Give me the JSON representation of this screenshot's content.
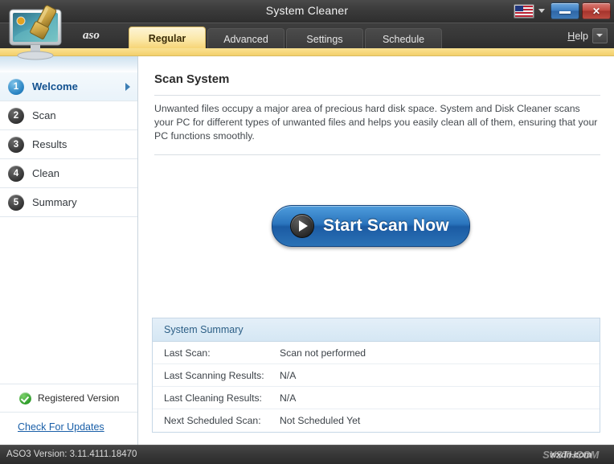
{
  "window": {
    "title": "System Cleaner",
    "flag_icon": "us-flag-icon",
    "flag_caret_icon": "caret-down-icon",
    "minimize_label": "",
    "close_label": "✕"
  },
  "brand": {
    "logo_icon": "monitor-brush-logo-icon",
    "aso_label": "aso"
  },
  "tabs": [
    {
      "label": "Regular",
      "active": true
    },
    {
      "label": "Advanced",
      "active": false
    },
    {
      "label": "Settings",
      "active": false
    },
    {
      "label": "Schedule",
      "active": false
    }
  ],
  "help": {
    "label_prefix": "H",
    "label_rest": "elp",
    "caret_icon": "chevron-down-icon"
  },
  "sidebar": {
    "items": [
      {
        "num": "1",
        "label": "Welcome",
        "active": true
      },
      {
        "num": "2",
        "label": "Scan",
        "active": false
      },
      {
        "num": "3",
        "label": "Results",
        "active": false
      },
      {
        "num": "4",
        "label": "Clean",
        "active": false
      },
      {
        "num": "5",
        "label": "Summary",
        "active": false
      }
    ],
    "registered_icon": "green-check-icon",
    "registered_label": "Registered Version",
    "updates_link": "Check For Updates"
  },
  "main": {
    "heading": "Scan System",
    "intro": "Unwanted files occupy a major area of precious hard disk space. System and Disk Cleaner scans your PC for different types of unwanted files and helps you easily clean all of them, ensuring that your PC functions smoothly.",
    "scan_button": {
      "label": "Start Scan Now",
      "icon": "play-icon"
    },
    "summary": {
      "title": "System Summary",
      "rows": [
        {
          "label": "Last Scan:",
          "value": "Scan not performed"
        },
        {
          "label": "Last Scanning Results:",
          "value": "N/A"
        },
        {
          "label": "Last Cleaning Results:",
          "value": "N/A"
        },
        {
          "label": "Next Scheduled Scan:",
          "value": "Not Scheduled Yet"
        }
      ]
    }
  },
  "statusbar": {
    "version_text": "ASO3 Version: 3.11.4111.18470",
    "watermark_back": "SYSTHCOM",
    "watermark_front": "wxdn.com"
  },
  "colors": {
    "accent_blue": "#2a74bd",
    "tab_active_gold": "#f6d372",
    "title_bar_dark": "#3c3c3c",
    "link_blue": "#1a5fa8",
    "panel_header_blue": "#d5e7f4",
    "registered_green": "#2f9d2a"
  }
}
